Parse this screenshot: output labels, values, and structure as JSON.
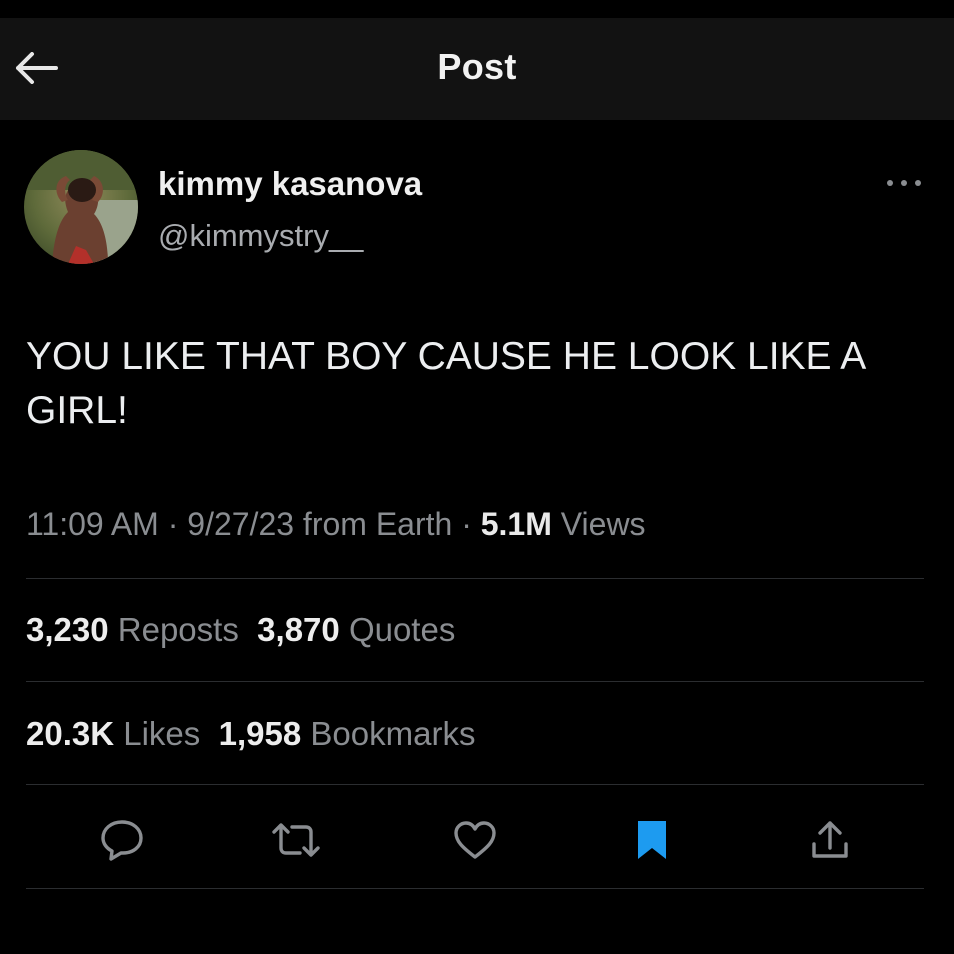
{
  "header": {
    "title": "Post",
    "back_icon": "arrow-left-icon"
  },
  "author": {
    "name": "kimmy kasanova",
    "handle": "@kimmystry__",
    "more_icon": "more-horizontal-icon"
  },
  "tweet": {
    "text": "YOU LIKE THAT BOY CAUSE HE LOOK LIKE A GIRL!"
  },
  "meta": {
    "time": "11:09 AM",
    "sep1": " · ",
    "date": "9/27/23",
    "source": " from Earth",
    "sep2": " · ",
    "views_count": "5.1M",
    "views_label": " Views"
  },
  "stats": {
    "reposts_count": "3,230",
    "reposts_label": "Reposts",
    "quotes_count": "3,870",
    "quotes_label": "Quotes",
    "likes_count": "20.3K",
    "likes_label": "Likes",
    "bookmarks_count": "1,958",
    "bookmarks_label": "Bookmarks"
  },
  "actions": [
    {
      "icon": "reply-icon"
    },
    {
      "icon": "repost-icon"
    },
    {
      "icon": "like-icon"
    },
    {
      "icon": "bookmark-icon",
      "active": true
    },
    {
      "icon": "share-icon"
    }
  ],
  "colors": {
    "background": "#000000",
    "header_bg": "#121212",
    "text_primary": "#e7e9ea",
    "text_secondary": "#8a8d91",
    "accent": "#1d9bf0",
    "divider": "#2b2d30"
  }
}
